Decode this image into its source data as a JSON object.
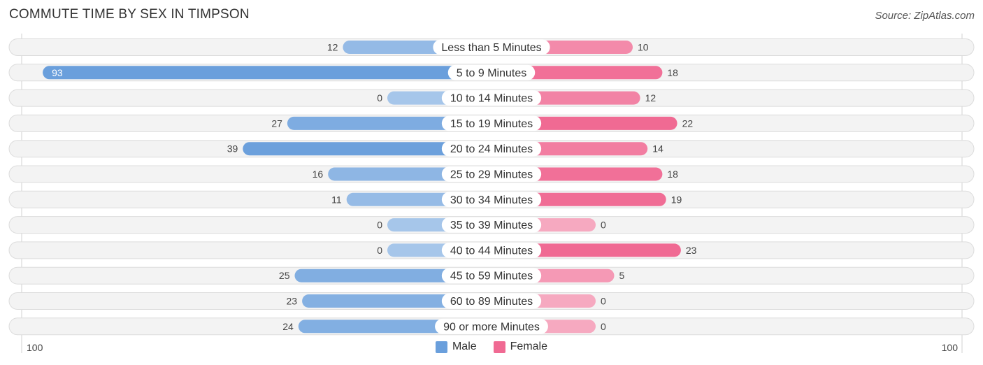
{
  "title": "COMMUTE TIME BY SEX IN TIMPSON",
  "source": "Source: ZipAtlas.com",
  "colors": {
    "male": "#6a9fdc",
    "male_light": "#a6c6ea",
    "female": "#f06a93",
    "female_light": "#f6a9c0",
    "row_bg": "#f3f3f3",
    "row_border": "#dcdcdc"
  },
  "legend": [
    {
      "label": "Male",
      "color": "#6a9fdc"
    },
    {
      "label": "Female",
      "color": "#f06a93"
    }
  ],
  "axis": {
    "left_label": "100",
    "right_label": "100"
  },
  "chart_data": {
    "type": "bar",
    "orientation": "horizontal-diverging",
    "title": "COMMUTE TIME BY SEX IN TIMPSON",
    "categories": [
      "Less than 5 Minutes",
      "5 to 9 Minutes",
      "10 to 14 Minutes",
      "15 to 19 Minutes",
      "20 to 24 Minutes",
      "25 to 29 Minutes",
      "30 to 34 Minutes",
      "35 to 39 Minutes",
      "40 to 44 Minutes",
      "45 to 59 Minutes",
      "60 to 89 Minutes",
      "90 or more Minutes"
    ],
    "series": [
      {
        "name": "Male",
        "side": "left",
        "values": [
          12,
          93,
          0,
          27,
          39,
          16,
          11,
          0,
          0,
          25,
          23,
          24
        ]
      },
      {
        "name": "Female",
        "side": "right",
        "values": [
          10,
          18,
          12,
          22,
          14,
          18,
          19,
          0,
          23,
          5,
          0,
          0
        ]
      }
    ],
    "xlim": [
      -100,
      100
    ],
    "xlabel": "",
    "ylabel": "",
    "tick_labels": [
      "100",
      "100"
    ],
    "legend_position": "bottom-center",
    "grid": false
  }
}
